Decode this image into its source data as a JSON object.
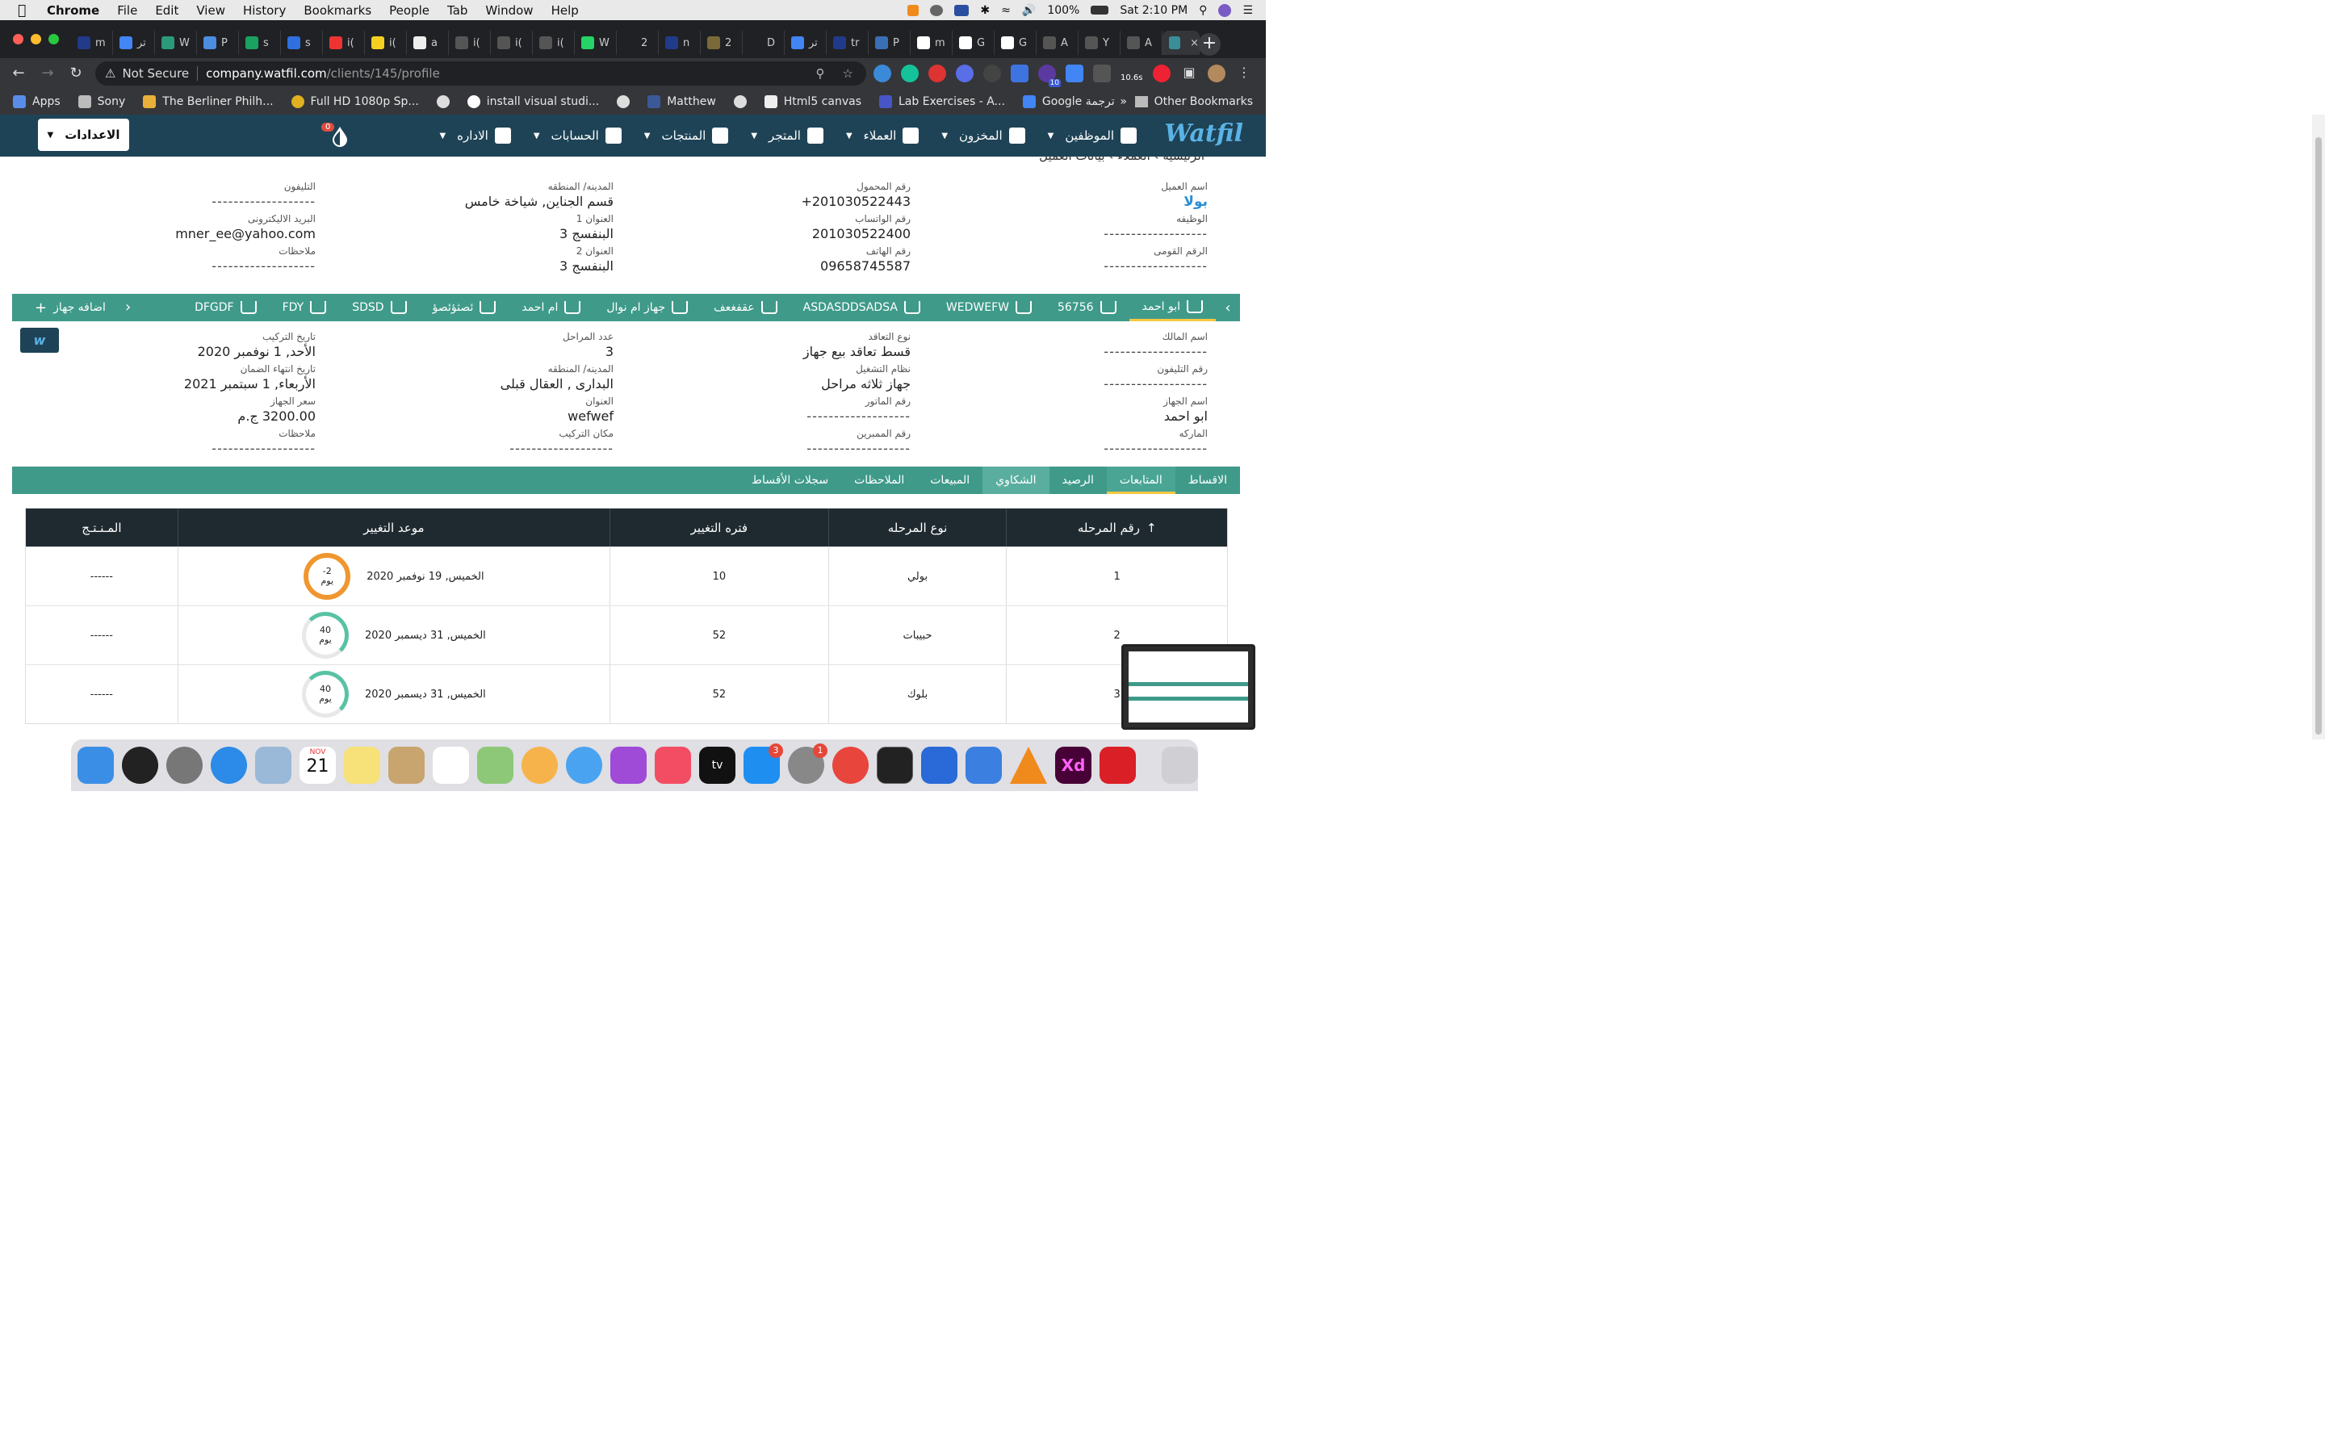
{
  "menubar": {
    "app": "Chrome",
    "items": [
      "File",
      "Edit",
      "View",
      "History",
      "Bookmarks",
      "People",
      "Tab",
      "Window",
      "Help"
    ],
    "battery": "100%",
    "clock": "Sat 2:10 PM"
  },
  "browser": {
    "tab_count_labels": [
      "m",
      "تر",
      "W",
      "P",
      "s",
      "s",
      "i(",
      "i(",
      "a",
      "i(",
      "i(",
      "i(",
      "W",
      "2",
      "n",
      "2",
      "D",
      "تر",
      "tr",
      "P",
      "m",
      "G",
      "G",
      "A",
      "Y",
      "A",
      ""
    ],
    "security": "Not Secure",
    "url_host": "company.watfil.com",
    "url_path": "/clients/145/profile",
    "ext_timer": "10.6s",
    "ext_badge": "10"
  },
  "bookmarks": {
    "items": [
      "Apps",
      "Sony",
      "The Berliner Philh...",
      "Full HD 1080p Sp...",
      "",
      "install visual studi...",
      "",
      "Matthew",
      "",
      "Html5 canvas",
      "Lab Exercises - A...",
      "Google ترجمة"
    ],
    "more": "»",
    "other": "Other Bookmarks"
  },
  "appnav": {
    "logo": "Watfil",
    "items": [
      "الموظفين",
      "المخزون",
      "العملاء",
      "المتجر",
      "المنتجات",
      "الحسابات",
      "الاداره"
    ],
    "drops_badge": "0",
    "settings": "الاعدادات"
  },
  "breadcrumb": "الرئيسيه › العملاء › بيانات العميل",
  "client": {
    "name_label": "اسم العميل",
    "name": "بولا",
    "job_label": "الوظيفه",
    "job": "-------------------",
    "nid_label": "الرقم القومى",
    "nid": "-------------------",
    "mobile_label": "رقم المحمول",
    "mobile": "+201030522443",
    "whatsapp_label": "رقم الواتساب",
    "whatsapp": "201030522400",
    "phone_label": "رقم الهاتف",
    "phone": "09658745587",
    "city_label": "المدينه/ المنطقه",
    "city": "قسم الجناين, شياخة خامس",
    "addr1_label": "العنوان 1",
    "addr1": "البنفسج 3",
    "addr2_label": "العنوان 2",
    "addr2": "البنفسج 3",
    "tel_label": "التليفون",
    "tel": "-------------------",
    "email_label": "البريد الاليكترونى",
    "email": "mner_ee@yahoo.com",
    "notes_label": "ملاحظات",
    "notes": "-------------------"
  },
  "devices": {
    "tabs": [
      "ابو احمد",
      "56756",
      "WEDWEFW",
      "ASDASDDSADSA",
      "عقفغعف",
      "جهاز ام نوال",
      "ام احمد",
      "ئصثؤئصؤ",
      "SDSD",
      "FDY",
      "DFGDF"
    ],
    "add": "اضافه جهاز"
  },
  "device": {
    "owner_label": "اسم المالك",
    "owner": "-------------------",
    "ownerphone_label": "رقم التليفون",
    "ownerphone": "-------------------",
    "devname_label": "اسم الجهاز",
    "devname": "ابو احمد",
    "brand_label": "الماركه",
    "brand": "-------------------",
    "contract_label": "نوع التعاقد",
    "contract": "قسط تعاقد بيع جهاز",
    "system_label": "نظام التشغيل",
    "system": "جهاز ثلاثه مراحل",
    "motor_label": "رقم الماتور",
    "motor": "-------------------",
    "membrane_label": "رقم الممبرين",
    "membrane": "-------------------",
    "stages_label": "عدد المراحل",
    "stages": "3",
    "dcity_label": "المدينه/ المنطقه",
    "dcity": "البدارى , العقال قبلى",
    "daddr_label": "العنوان",
    "daddr": "wefwef",
    "place_label": "مكان التركيب",
    "place": "-------------------",
    "install_label": "تاريخ التركيب",
    "install": "الأحد, 1 نوفمبر 2020",
    "warranty_label": "تاريخ انتهاء الضمان",
    "warranty": "الأربعاء, 1 سبتمبر 2021",
    "price_label": "سعر الجهاز",
    "price": "3200.00 ج.م",
    "dnotes_label": "ملاحظات",
    "dnotes": "-------------------"
  },
  "section_tabs": [
    "الاقساط",
    "المتابعات",
    "الرصيد",
    "الشكاوي",
    "المبيعات",
    "الملاحظات",
    "سجلات الأقساط"
  ],
  "table": {
    "headers": [
      "رقم المرحله",
      "نوع المرحله",
      "فتره التغيير",
      "موعد التغيير",
      "المـنـتـج"
    ],
    "sort_icon": "↑",
    "rows": [
      {
        "num": "1",
        "type": "بولي",
        "period": "10",
        "date": "الخميس, 19 نوفمبر 2020",
        "ring_num": "-2",
        "ring_unit": "يوم",
        "product": "------"
      },
      {
        "num": "2",
        "type": "حبيبات",
        "period": "52",
        "date": "الخميس, 31 ديسمبر 2020",
        "ring_num": "40",
        "ring_unit": "يوم",
        "product": "------"
      },
      {
        "num": "3",
        "type": "بلوك",
        "period": "52",
        "date": "الخميس, 31 ديسمبر 2020",
        "ring_num": "40",
        "ring_unit": "يوم",
        "product": "------"
      }
    ]
  },
  "dock": {
    "calendar_month": "NOV",
    "calendar_day": "21",
    "appstore_badge": "3",
    "settings_badge": "1",
    "tv_label": "tv",
    "xd_label": "Xd"
  }
}
